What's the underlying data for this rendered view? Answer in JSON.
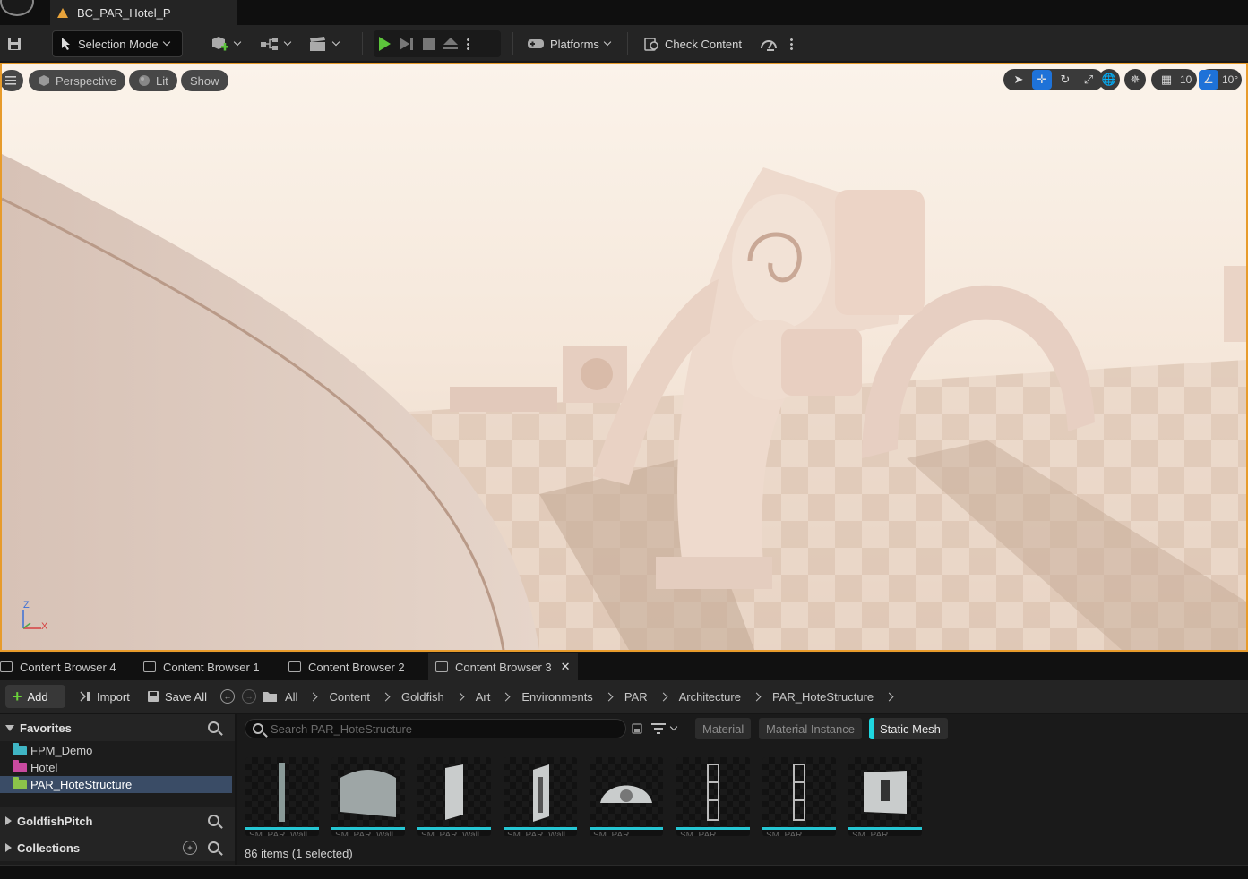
{
  "titlebar": {
    "doc_tab": "BC_PAR_Hotel_P"
  },
  "toolbar": {
    "selection_mode": "Selection Mode",
    "platforms": "Platforms",
    "check_content": "Check Content"
  },
  "viewport": {
    "perspective": "Perspective",
    "lit": "Lit",
    "show": "Show",
    "grid_size": "10",
    "rotation_snap": "10°",
    "axis_z": "Z",
    "axis_x": "X"
  },
  "content_browser": {
    "tabs": [
      {
        "label": "Content Browser 4"
      },
      {
        "label": "Content Browser 1"
      },
      {
        "label": "Content Browser 2"
      },
      {
        "label": "Content Browser 3"
      }
    ],
    "add_label": "Add",
    "import_label": "Import",
    "save_all_label": "Save All",
    "breadcrumb": [
      "All",
      "Content",
      "Goldfish",
      "Art",
      "Environments",
      "PAR",
      "Architecture",
      "PAR_HoteStructure"
    ],
    "favorites_label": "Favorites",
    "favorites": [
      {
        "label": "FPM_Demo",
        "color": "#3fb5c4"
      },
      {
        "label": "Hotel",
        "color": "#c94aa0"
      },
      {
        "label": "PAR_HoteStructure",
        "color": "#8bc34a"
      }
    ],
    "goldfishpitch_label": "GoldfishPitch",
    "collections_label": "Collections",
    "search_placeholder": "Search PAR_HoteStructure",
    "filters": [
      "Material",
      "Material Instance",
      "Static Mesh"
    ],
    "item_count": "86 items (1 selected)",
    "assets": [
      {
        "label": "SM_PAR_Wall"
      },
      {
        "label": "SM_PAR_Wall"
      },
      {
        "label": "SM_PAR_Wall"
      },
      {
        "label": "SM_PAR_Wall"
      },
      {
        "label": "SM_PAR"
      },
      {
        "label": "SM_PAR"
      },
      {
        "label": "SM_PAR"
      },
      {
        "label": "SM_PAR"
      }
    ]
  },
  "colors": {
    "accent": "#e79b2b",
    "selection": "#1e72d8",
    "static_mesh": "#1fd7e0"
  }
}
